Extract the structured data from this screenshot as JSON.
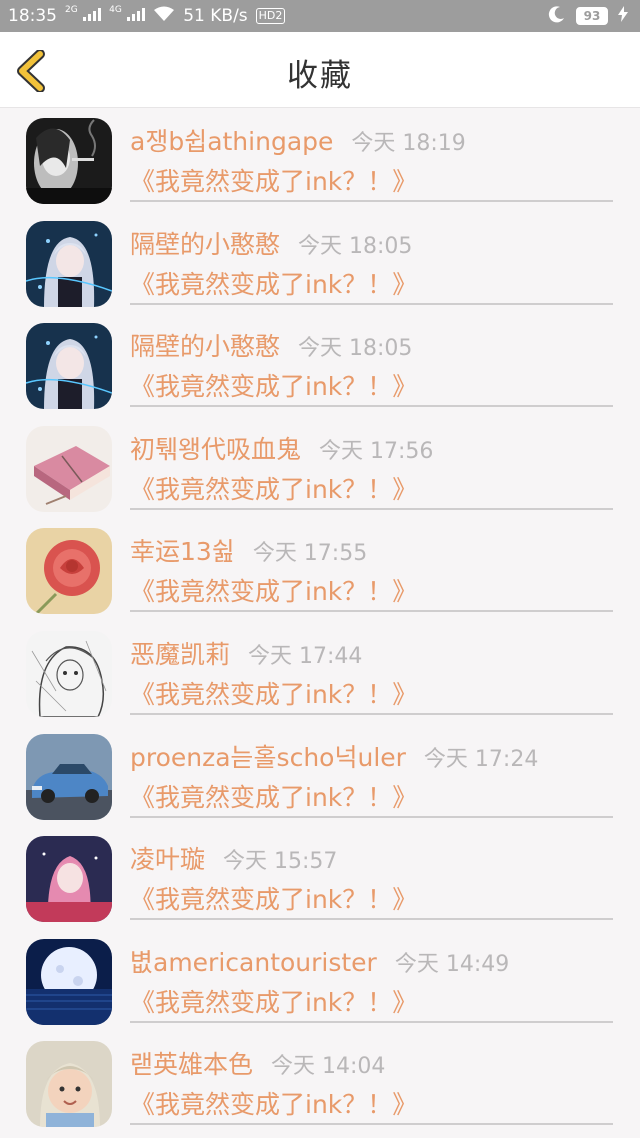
{
  "status_bar": {
    "time": "18:35",
    "net_2g": "2G",
    "net_4g": "4G",
    "speed": "51 KB/s",
    "hd": "HD2",
    "battery": "93"
  },
  "header": {
    "title": "收藏"
  },
  "items": [
    {
      "username": "a쟁b쉽athingape",
      "time": "今天  18:19",
      "title": "《我竟然变成了ink？！》",
      "avatar": "dark-smoking-portrait"
    },
    {
      "username": "隔壁的小憨憨",
      "time": "今天  18:05",
      "title": "《我竟然变成了ink？！》",
      "avatar": "anime-girl-blue"
    },
    {
      "username": "隔壁的小憨憨",
      "time": "今天  18:05",
      "title": "《我竟然变成了ink？！》",
      "avatar": "anime-girl-blue"
    },
    {
      "username": "初퉦왱代吸血鬼",
      "time": "今天  17:56",
      "title": "《我竟然变成了ink？！》",
      "avatar": "pink-book"
    },
    {
      "username": "幸运13쉺",
      "time": "今天  17:55",
      "title": "《我竟然变成了ink？！》",
      "avatar": "red-rose"
    },
    {
      "username": "恶魔凯莉",
      "time": "今天  17:44",
      "title": "《我竟然变成了ink？！》",
      "avatar": "sketch-girl"
    },
    {
      "username": "proenza늗홀scho넉uler",
      "time": "今天  17:24",
      "title": "《我竟然变成了ink？！》",
      "avatar": "blue-car"
    },
    {
      "username": "凌叶璇",
      "time": "今天  15:57",
      "title": "《我竟然变成了ink？！》",
      "avatar": "pink-hair-girl"
    },
    {
      "username": "볎americantourister",
      "time": "今天  14:49",
      "title": "《我竟然变成了ink？！》",
      "avatar": "moon-night"
    },
    {
      "username": "랟英雄本色",
      "time": "今天  14:04",
      "title": "《我竟然变成了ink？！》",
      "avatar": "baby-photo"
    }
  ],
  "colors": {
    "accent": "#e89a6a",
    "back_chevron": "#f2c23a",
    "muted": "#b9b7b8"
  }
}
